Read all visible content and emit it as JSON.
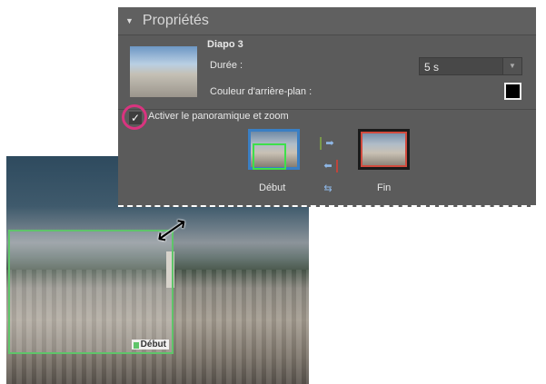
{
  "panel": {
    "title": "Propriétés",
    "slide_name": "Diapo 3",
    "duration_label": "Durée :",
    "duration_value": "5 s",
    "bg_color_label": "Couleur d'arrière-plan :",
    "bg_color": "#000000",
    "pan_zoom_label": "Activer le panoramique et zoom",
    "pan_zoom_checked": true,
    "start_label": "Début",
    "end_label": "Fin"
  },
  "photo": {
    "crop_label": "Début"
  },
  "colors": {
    "accent_highlight": "#d9347f",
    "start_frame": "#3ee04a",
    "end_frame": "#d24b3e"
  }
}
